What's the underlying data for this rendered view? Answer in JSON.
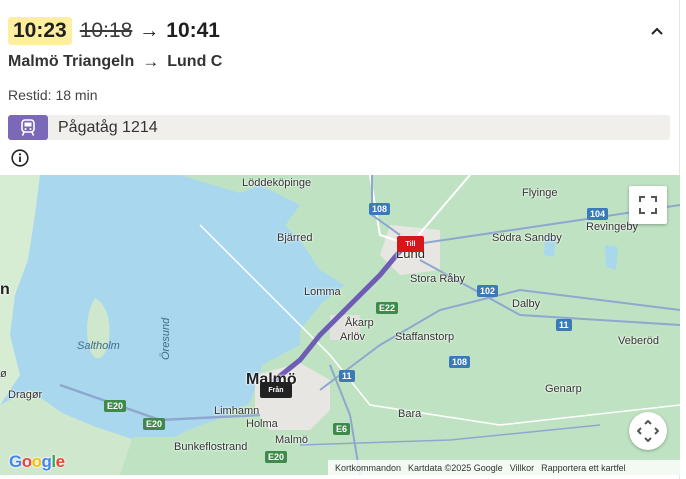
{
  "trip": {
    "departure_new": "10:23",
    "departure_old": "10:18",
    "arrival": "10:41",
    "origin": "Malmö Triangeln",
    "destination": "Lund C",
    "duration": "Restid: 18 min",
    "train": "Pågatåg 1214"
  },
  "icons": {
    "arrow": "→",
    "collapse": "chevron-up-icon",
    "train": "train-icon",
    "info": "info-icon",
    "fullscreen": "fullscreen-icon",
    "pan": "pan-control-icon"
  },
  "colors": {
    "delay_highlight": "#fdeea0",
    "train_badge": "#7b69b8",
    "route_line": "#6f5cb5",
    "pin_till": "#d4171a",
    "pin_fran": "#222222",
    "water": "#a9d8ee",
    "land": "#bfe3c2"
  },
  "map": {
    "pins": {
      "destination": "Till",
      "origin": "Från"
    },
    "places": {
      "loddekopinge": "Löddeköpinge",
      "bjarred": "Bjärred",
      "flyinge": "Flyinge",
      "sodra_sandby": "Södra Sandby",
      "revingeby": "Revingeby",
      "lund": "Lund",
      "stora_raby": "Stora Råby",
      "lomma": "Lomma",
      "akarp": "Åkarp",
      "arlov": "Arlöv",
      "staffanstorp": "Staffanstorp",
      "dalby": "Dalby",
      "veberod": "Veberöd",
      "saltholm": "Saltholm",
      "oresund": "Öresund",
      "malmo": "Malmö",
      "malmo_small": "Malmö",
      "limhamn": "Limhamn",
      "holma": "Holma",
      "bunkeflostrand": "Bunkeflostrand",
      "genarp": "Genarp",
      "bara": "Bara",
      "dragor": "Dragør",
      "edge_left": "n",
      "edge_left2": "ø"
    },
    "roads": {
      "r108a": "108",
      "r104": "104",
      "r102": "102",
      "e22": "E22",
      "r11a": "11",
      "r108b": "108",
      "r11b": "11",
      "e20a": "E20",
      "e20b": "E20",
      "e6": "E6",
      "e20c": "E20"
    },
    "google_letters": [
      "G",
      "o",
      "o",
      "g",
      "l",
      "e"
    ],
    "attribution": {
      "shortcuts": "Kortkommandon",
      "data": "Kartdata ©2025 Google",
      "terms": "Villkor",
      "report": "Rapportera ett kartfel"
    }
  }
}
